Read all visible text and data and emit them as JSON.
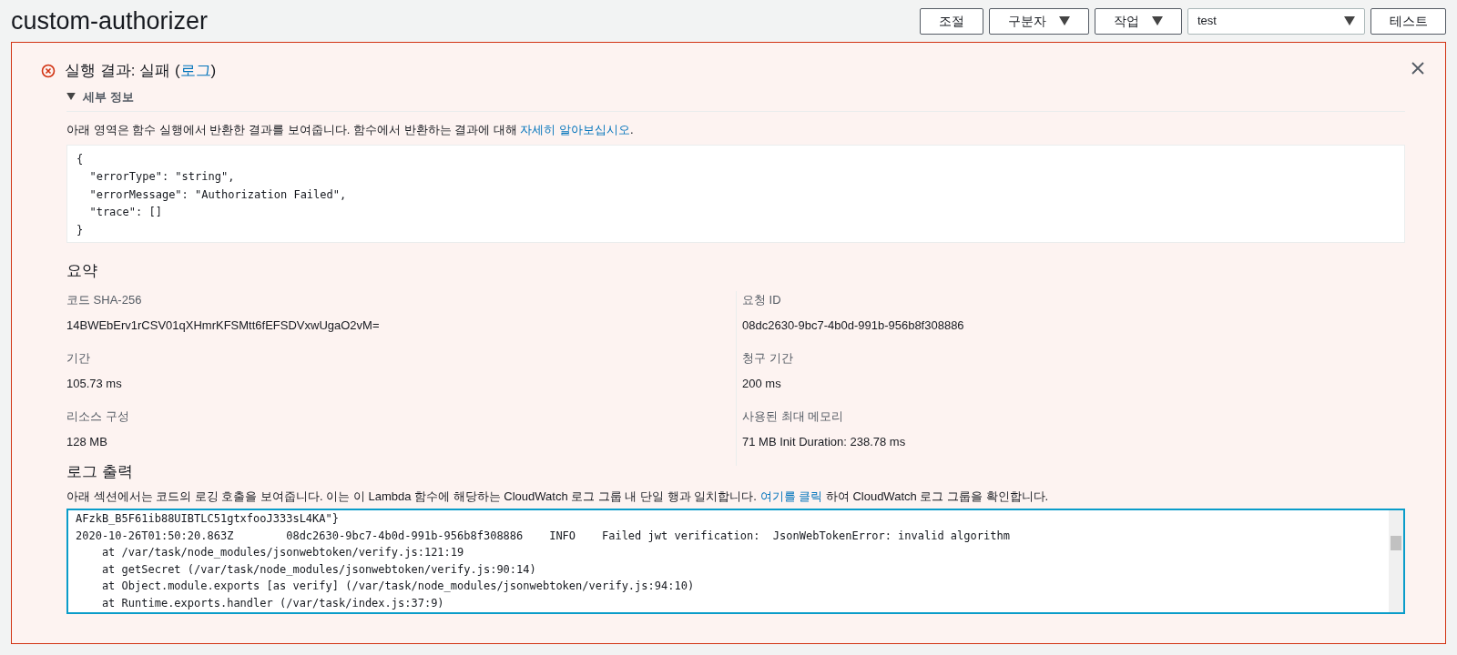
{
  "page_title": "custom-authorizer",
  "toolbar": {
    "buttons": [
      {
        "label": "조절",
        "kind": "button"
      },
      {
        "label": "구분자",
        "kind": "dropdown"
      },
      {
        "label": "작업",
        "kind": "dropdown"
      }
    ],
    "test_event_select": {
      "value": "test"
    },
    "test_button": "테스트"
  },
  "result": {
    "failed": true,
    "title_before": "실행 결과: 실패 (",
    "title_link": "로그",
    "title_after": ")",
    "details": {
      "label": "세부 정보",
      "expanded": true
    },
    "description": {
      "before": "아래 영역은 함수 실행에서 반환한 결과를 보여줍니다. 함수에서 반환하는 결과에 대해 ",
      "link": "자세히 알아보십시오",
      "after": "."
    },
    "output_lines": [
      "{",
      "  \"errorType\": \"string\",",
      "  \"errorMessage\": \"Authorization Failed\",",
      "  \"trace\": []",
      "}"
    ],
    "summary": {
      "heading": "요약",
      "fields": [
        {
          "label": "코드 SHA-256",
          "value": "14BWEbErv1rCSV01qXHmrKFSMtt6fEFSDVxwUgaO2vM="
        },
        {
          "label": "요청 ID",
          "value": "08dc2630-9bc7-4b0d-991b-956b8f308886"
        },
        {
          "label": "기간",
          "value": "105.73 ms"
        },
        {
          "label": "청구 기간",
          "value": "200 ms"
        },
        {
          "label": "리소스 구성",
          "value": "128 MB"
        },
        {
          "label": "사용된 최대 메모리",
          "value": "71 MB Init Duration: 238.78 ms"
        }
      ]
    },
    "log": {
      "heading": "로그 출력",
      "description": {
        "before": "아래 섹션에서는 코드의 로깅 호출을 보여줍니다. 이는 이 Lambda 함수에 해당하는 CloudWatch 로그 그룹 내 단일 행과 일치합니다. ",
        "link": "여기를 클릭",
        "after": " 하여 CloudWatch 로그 그룹을 확인합니다."
      },
      "lines": [
        "AFzkB_B5F61ib88UIBTLC51gtxfooJ333sL4KA\"}",
        "2020-10-26T01:50:20.863Z\t08dc2630-9bc7-4b0d-991b-956b8f308886\tINFO\tFailed jwt verification:  JsonWebTokenError: invalid algorithm",
        "    at /var/task/node_modules/jsonwebtoken/verify.js:121:19",
        "    at getSecret (/var/task/node_modules/jsonwebtoken/verify.js:90:14)",
        "    at Object.module.exports [as verify] (/var/task/node_modules/jsonwebtoken/verify.js:94:10)",
        "    at Runtime.exports.handler (/var/task/index.js:37:9)"
      ]
    }
  }
}
